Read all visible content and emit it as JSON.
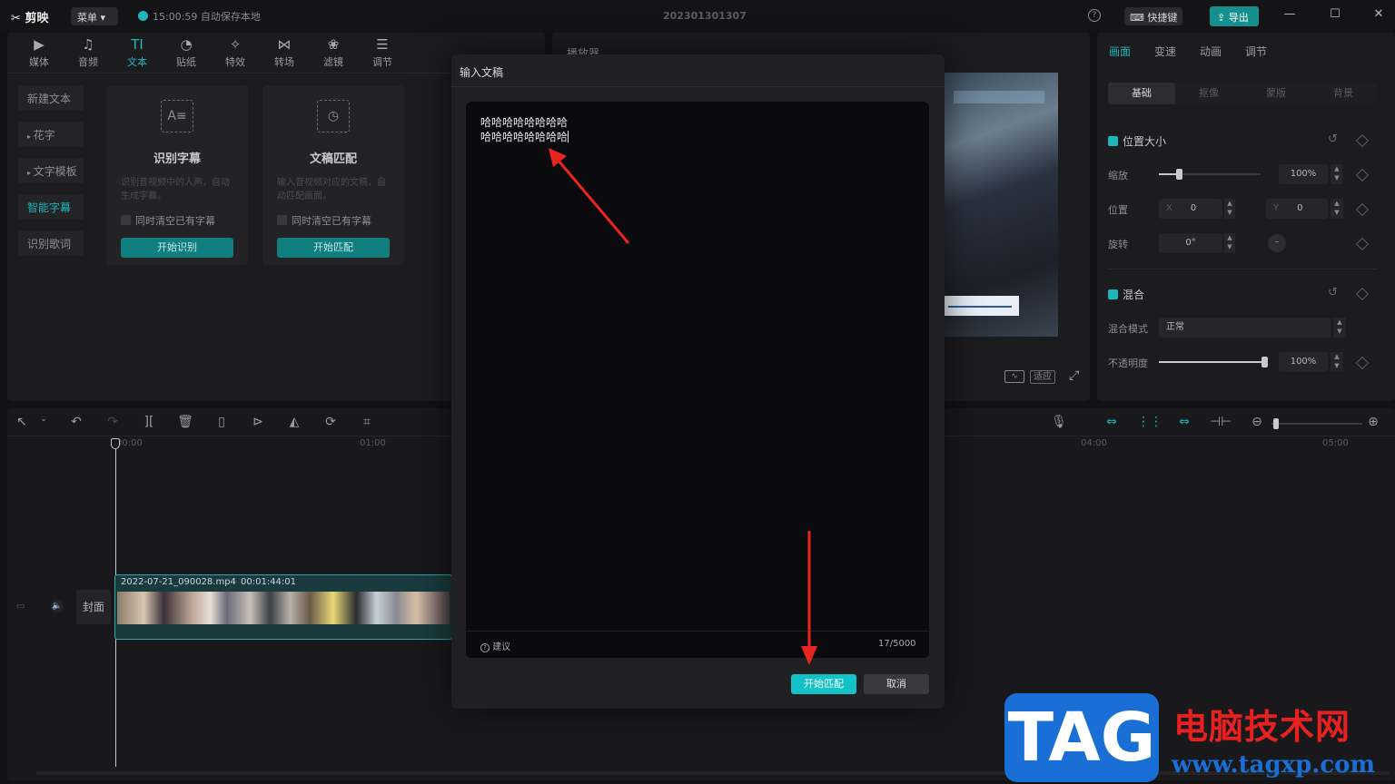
{
  "titlebar": {
    "logo": "剪映",
    "menu_label": "菜单",
    "save_status": "15:00:59 自动保存本地",
    "project_title": "202301301307",
    "shortcut_label": "快捷键",
    "export_label": "导出"
  },
  "toolbar_tabs": [
    {
      "label": "媒体",
      "icon": "media-icon"
    },
    {
      "label": "音频",
      "icon": "audio-icon"
    },
    {
      "label": "文本",
      "icon": "text-icon"
    },
    {
      "label": "贴纸",
      "icon": "sticker-icon"
    },
    {
      "label": "特效",
      "icon": "effects-icon"
    },
    {
      "label": "转场",
      "icon": "transition-icon"
    },
    {
      "label": "滤镜",
      "icon": "filter-icon"
    },
    {
      "label": "调节",
      "icon": "adjust-icon"
    }
  ],
  "sidebar": {
    "items": [
      "新建文本",
      "花字",
      "文字模板",
      "智能字幕",
      "识别歌词"
    ],
    "active": "智能字幕"
  },
  "cards": {
    "recognize": {
      "title": "识别字幕",
      "desc": "识别音视频中的人声，自动生成字幕。",
      "checkbox": "同时清空已有字幕",
      "button": "开始识别"
    },
    "match": {
      "title": "文稿匹配",
      "desc": "输入音视频对应的文稿，自动匹配画面。",
      "checkbox": "同时清空已有字幕",
      "button": "开始匹配"
    }
  },
  "player": {
    "title": "播放器",
    "fit_label": "适应"
  },
  "properties": {
    "tabs": [
      "画面",
      "变速",
      "动画",
      "调节"
    ],
    "subtabs": [
      "基础",
      "抠像",
      "蒙版",
      "背景"
    ],
    "position_size": "位置大小",
    "scale_label": "缩放",
    "scale_value": "100%",
    "position_label": "位置",
    "pos_x_label": "X",
    "pos_x": "0",
    "pos_y_label": "Y",
    "pos_y": "0",
    "rotate_label": "旋转",
    "rotate_value": "0°",
    "blend_title": "混合",
    "blend_mode_label": "混合模式",
    "blend_mode_value": "正常",
    "opacity_label": "不透明度",
    "opacity_value": "100%",
    "scale_fraction": 0.2,
    "opacity_fraction": 1.0
  },
  "timeline": {
    "ruler": [
      "00:00",
      "01:00",
      "04:00",
      "05:00"
    ],
    "clip_name": "2022-07-21_090028.mp4",
    "clip_duration": "00:01:44:01",
    "cover_label": "封面"
  },
  "dialog": {
    "title": "输入文稿",
    "lines": [
      "哈哈哈哈哈哈哈哈",
      "哈哈哈哈哈哈哈哈"
    ],
    "suggest": "建议",
    "counter": "17/5000",
    "confirm": "开始匹配",
    "cancel": "取消"
  },
  "watermark": {
    "tag": "TAG",
    "name": "电脑技术网",
    "url": "www.tagxp.com"
  },
  "colors": {
    "accent": "#1fb5ba",
    "arrow": "#e8261f",
    "dialog_confirm": "#13c2c6"
  }
}
